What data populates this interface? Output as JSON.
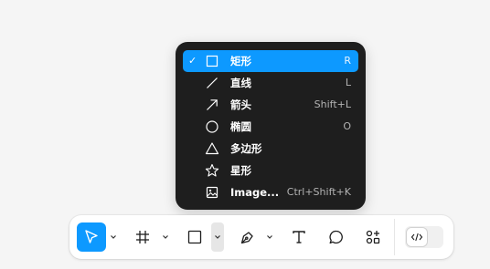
{
  "shape_menu": {
    "items": [
      {
        "icon": "rectangle-icon",
        "label": "矩形",
        "shortcut": "R",
        "checked": true
      },
      {
        "icon": "line-icon",
        "label": "直线",
        "shortcut": "L",
        "checked": false
      },
      {
        "icon": "arrow-icon",
        "label": "箭头",
        "shortcut": "Shift+L",
        "checked": false
      },
      {
        "icon": "ellipse-icon",
        "label": "椭圆",
        "shortcut": "O",
        "checked": false
      },
      {
        "icon": "polygon-icon",
        "label": "多边形",
        "shortcut": "",
        "checked": false
      },
      {
        "icon": "star-icon",
        "label": "星形",
        "shortcut": "",
        "checked": false
      },
      {
        "icon": "image-icon",
        "label": "Image...",
        "shortcut": "Ctrl+Shift+K",
        "checked": false
      }
    ],
    "check_mark": "✓"
  },
  "toolbar": {
    "tools": [
      {
        "icon": "move-cursor-icon",
        "active": true,
        "has_dropdown": true
      },
      {
        "icon": "frame-hash-icon",
        "active": false,
        "has_dropdown": true
      },
      {
        "icon": "rectangle-icon",
        "active": false,
        "has_dropdown": true,
        "dropdown_open": true
      },
      {
        "icon": "pen-icon",
        "active": false,
        "has_dropdown": true
      },
      {
        "icon": "text-icon",
        "active": false,
        "has_dropdown": false
      },
      {
        "icon": "comment-icon",
        "active": false,
        "has_dropdown": false
      },
      {
        "icon": "actions-icon",
        "active": false,
        "has_dropdown": false
      }
    ],
    "dev_mode": {
      "icon": "code-icon",
      "enabled": false
    }
  },
  "colors": {
    "accent": "#0d99ff",
    "menu_bg": "#1e1e1e",
    "toolbar_bg": "#ffffff",
    "canvas_bg": "#f5f5f5"
  }
}
